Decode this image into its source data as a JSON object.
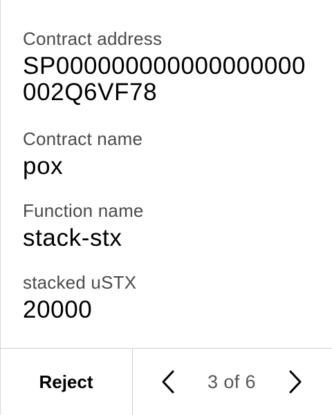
{
  "fields": {
    "contract_address": {
      "label": "Contract address",
      "value": "SP000000000000000000002Q6VF78"
    },
    "contract_name": {
      "label": "Contract name",
      "value": "pox"
    },
    "function_name": {
      "label": "Function name",
      "value": "stack-stx"
    },
    "stacked_ustx": {
      "label": "stacked uSTX",
      "value": "20000"
    }
  },
  "footer": {
    "reject_label": "Reject",
    "pagination": "3 of 6",
    "prev_icon": "chevron-left-icon",
    "next_icon": "chevron-right-icon"
  }
}
